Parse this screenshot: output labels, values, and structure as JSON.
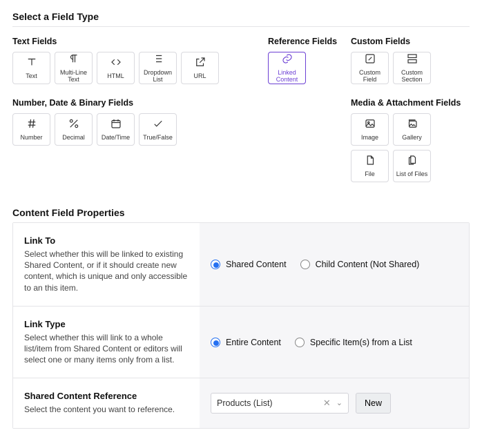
{
  "header": {
    "select_field_type": "Select a Field Type"
  },
  "groups": {
    "text": {
      "heading": "Text Fields"
    },
    "reference": {
      "heading": "Reference Fields"
    },
    "custom": {
      "heading": "Custom Fields"
    },
    "number": {
      "heading": "Number, Date & Binary Fields"
    },
    "media": {
      "heading": "Media & Attachment Fields"
    }
  },
  "tiles": {
    "text": "Text",
    "multiline": "Multi-Line Text",
    "html": "HTML",
    "dropdown": "Dropdown List",
    "url": "URL",
    "linked": "Linked Content",
    "custom_field": "Custom Field",
    "custom_section": "Custom Section",
    "number": "Number",
    "decimal": "Decimal",
    "datetime": "Date/Time",
    "truefalse": "True/False",
    "image": "Image",
    "gallery": "Gallery",
    "file": "File",
    "listfiles": "List of Files"
  },
  "props_heading": "Content Field Properties",
  "props": {
    "link_to": {
      "label": "Link To",
      "desc": "Select whether this will be linked to existing Shared Content, or if it should create new content, which is unique and only accessible to an this item.",
      "opt_shared": "Shared Content",
      "opt_child": "Child Content (Not Shared)"
    },
    "link_type": {
      "label": "Link Type",
      "desc": "Select whether this will link to a whole list/item from Shared Content or editors will select one or many items only from a list.",
      "opt_entire": "Entire Content",
      "opt_specific": "Specific Item(s) from a List"
    },
    "ref": {
      "label": "Shared Content Reference",
      "desc": "Select the content you want to reference.",
      "value": "Products (List)",
      "new_btn": "New"
    }
  }
}
